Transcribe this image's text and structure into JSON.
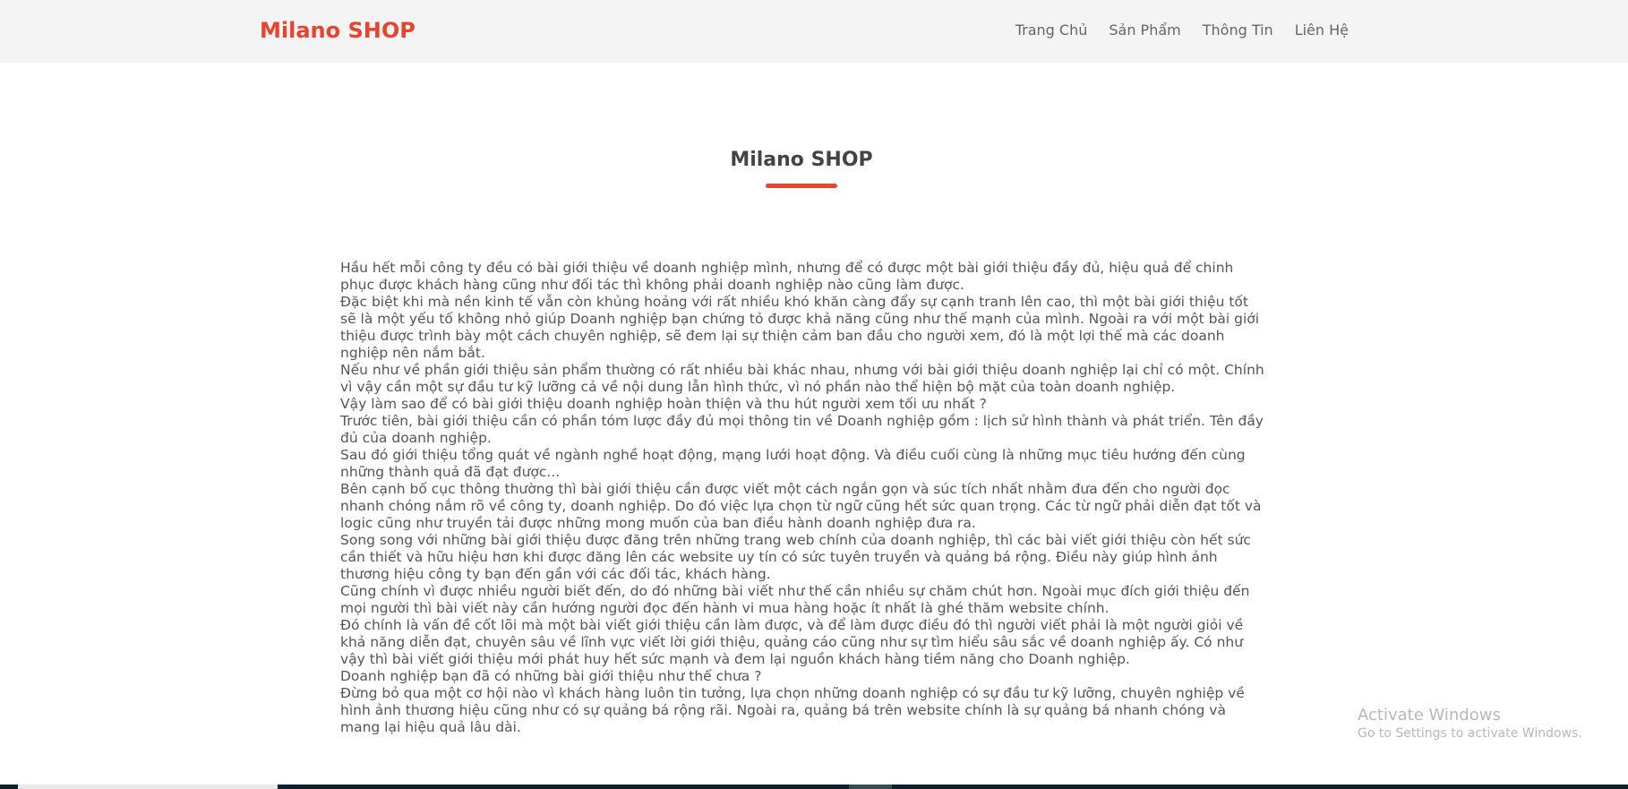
{
  "brand": {
    "name": "Milano SHOP",
    "color": "#e8432f"
  },
  "nav": {
    "items": [
      {
        "label": "Trang Chủ"
      },
      {
        "label": "Sản Phẩm"
      },
      {
        "label": "Thông Tin"
      },
      {
        "label": "Liên Hệ"
      }
    ]
  },
  "main": {
    "title": "Milano SHOP",
    "paragraphs": [
      "Hầu hết mỗi công ty đều có bài giới thiệu về doanh nghiệp mình, nhưng để có được một bài giới thiệu đầy đủ, hiệu quả để chinh phục được khách hàng cũng như đối tác thì không phải doanh nghiệp nào cũng làm được.",
      "Đặc biệt khi mà nền kinh tế vẫn còn khủng hoảng với rất nhiều khó khăn càng đẩy sự cạnh tranh lên cao, thì một bài giới thiệu tốt sẽ là một yếu tố không nhỏ giúp Doanh nghiệp bạn chứng tỏ được khả năng cũng như thế mạnh của mình. Ngoài ra với một bài giới thiệu được trình bày một cách chuyên nghiệp, sẽ đem lại sự thiện cảm ban đầu cho người xem, đó là một lợi thế mà các doanh nghiệp nên nắm bắt.",
      "Nếu như về phần giới thiệu sản phẩm thường có rất nhiều bài khác nhau, nhưng với bài giới thiệu doanh nghiệp lại chỉ có một. Chính vì vậy cần một sự đầu tư kỹ lưỡng cả về nội dung lẫn hình thức, vì nó phần nào thể hiện bộ mặt của toàn doanh nghiệp.",
      "Vậy làm sao để có bài giới thiệu doanh nghiệp hoàn thiện và thu hút người xem tối ưu nhất ?",
      "Trước tiên, bài giới thiệu cần có phần tóm lược đầy đủ mọi thông tin về Doanh nghiệp gồm : lịch sử hình thành và phát triển. Tên đầy đủ của doanh nghiệp.",
      "Sau đó giới thiệu tổng quát về ngành nghề hoạt động, mạng lưới hoạt động. Và điều cuối cùng là những mục tiêu hướng đến cùng những thành quả đã đạt được...",
      "Bên cạnh bố cục thông thường thì bài giới thiệu cần được viết một cách ngắn gọn và súc tích nhất nhằm đưa đến cho người đọc nhanh chóng nắm rõ về công ty, doanh nghiệp. Do đó việc lựa chọn từ ngữ cũng hết sức quan trọng. Các từ ngữ phải diễn đạt tốt và logic cũng như truyền tải được những mong muốn của ban điều hành doanh nghiệp đưa ra.",
      "Song song với những bài giới thiệu được đăng trên những trang web chính của doanh nghiệp, thì các bài viết giới thiệu còn hết sức cần thiết và hữu hiệu hơn khi được đăng lên các website uy tín có sức tuyên truyền và quảng bá rộng. Điều này giúp hình ảnh thương hiệu công ty bạn đến gần với các đối tác, khách hàng.",
      "Cũng chính vì được nhiều người biết đến, do đó những bài viết như thế cần nhiều sự chăm chút hơn. Ngoài mục đích giới thiệu đến mọi người thì bài viết này cần hướng người đọc đến hành vi mua hàng hoặc ít nhất là ghé thăm website chính.",
      "Đó chính là vấn đề cốt lõi mà một bài viết giới thiệu cần làm được, và để làm được điều đó thì người viết phải là một người giỏi về khả năng diễn đạt, chuyên sâu về lĩnh vực viết lời giới thiệu, quảng cáo cũng như sự tìm hiểu sâu sắc về doanh nghiệp ấy. Có như vậy thì bài viết giới thiệu mới phát huy hết sức mạnh và đem lại nguồn khách hàng tiềm năng cho Doanh nghiệp.",
      "Doanh nghiệp bạn đã có những bài giới thiệu như thế chưa ?",
      "Đừng bỏ qua một cơ hội nào vì khách hàng luôn tin tưởng, lựa chọn những doanh nghiệp có sự đầu tư kỹ lưỡng, chuyên nghiệp về hình ảnh thương hiệu cũng như có sự quảng bá rộng rãi. Ngoài ra, quảng bá trên website chính là sự quảng bá nhanh chóng và mang lại hiệu quả lâu dài."
    ]
  },
  "watermark": {
    "title": "Activate Windows",
    "subtitle": "Go to Settings to activate Windows."
  },
  "colors": {
    "accent": "#e8432f",
    "navbar_bg": "#f4f4f4",
    "taskbar": "#10202b"
  }
}
